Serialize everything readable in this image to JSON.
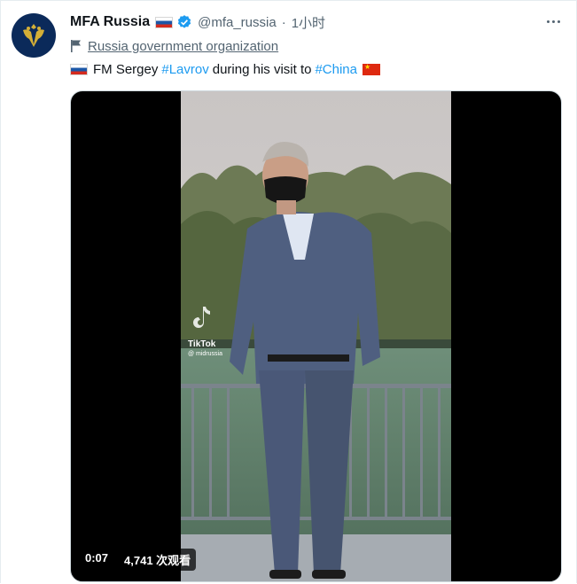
{
  "tweet": {
    "author_name": "MFA Russia",
    "handle": "@mfa_russia",
    "separator": "·",
    "time": "1小时",
    "label": "Russia government organization",
    "text_prefix": "FM Sergey",
    "hashtag_1": "#Lavrov",
    "text_middle": "during his visit to",
    "hashtag_2": "#China"
  },
  "video": {
    "elapsed": "0:07",
    "views": "4,741 次观看",
    "watermark_brand": "TikTok",
    "watermark_handle": "@ midrussia"
  },
  "icons": {
    "verified": "verified-badge-icon",
    "label": "flag-icon",
    "more": "more-options-icon",
    "flag_russia": "russia-flag-icon",
    "flag_china": "china-flag-icon"
  },
  "colors": {
    "link": "#1d9bf0",
    "muted": "#536471",
    "text": "#0f1419"
  }
}
